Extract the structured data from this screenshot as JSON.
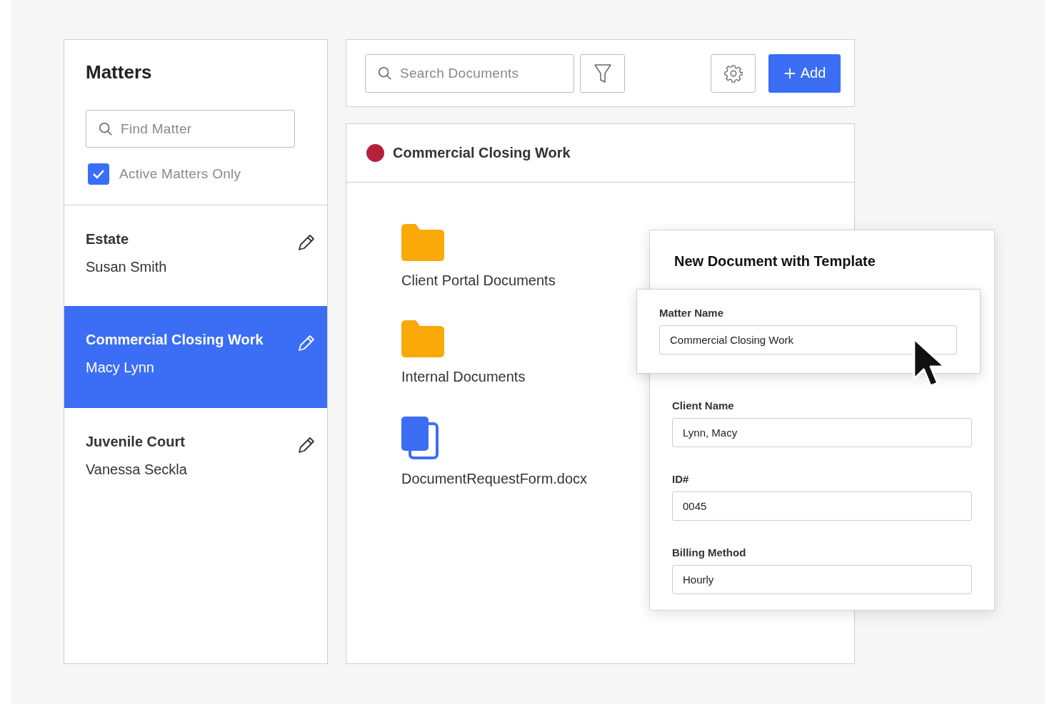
{
  "sidebar": {
    "title": "Matters",
    "search": {
      "placeholder": "Find Matter"
    },
    "filter": {
      "label": "Active Matters Only",
      "checked": true
    },
    "items": [
      {
        "title": "Estate",
        "client": "Susan Smith",
        "selected": false
      },
      {
        "title": "Commercial Closing Work",
        "client": "Macy Lynn",
        "selected": true
      },
      {
        "title": "Juvenile Court",
        "client": "Vanessa Seckla",
        "selected": false
      }
    ]
  },
  "toolbar": {
    "search": {
      "placeholder": "Search Documents"
    },
    "add_button": "Add"
  },
  "matter": {
    "title": "Commercial Closing Work"
  },
  "documents": [
    {
      "name": "Client Portal Documents",
      "kind": "folder"
    },
    {
      "name": "Internal Documents",
      "kind": "folder"
    },
    {
      "name": "DocumentRequestForm.docx",
      "kind": "file"
    }
  ],
  "dialog": {
    "title": "New Document with Template",
    "fields": [
      {
        "label": "Matter Name",
        "value": "Commercial Closing Work",
        "highlighted": true
      },
      {
        "label": "Client Name",
        "value": "Lynn, Macy",
        "highlighted": false
      },
      {
        "label": "ID#",
        "value": "0045",
        "highlighted": false
      },
      {
        "label": "Billing Method",
        "value": "Hourly",
        "highlighted": false
      }
    ]
  }
}
